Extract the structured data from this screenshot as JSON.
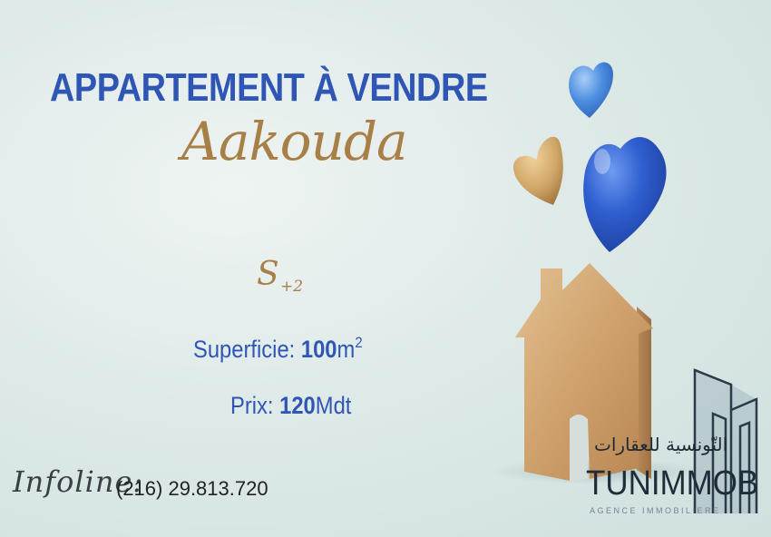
{
  "listing": {
    "title": "APPARTEMENT À VENDRE",
    "location": "Aakouda",
    "type_main": "S",
    "type_sup": "+2",
    "surface_label": "Superficie:",
    "surface_value": "100",
    "surface_unit": "m",
    "surface_sup": "2",
    "price_label": "Prix:",
    "price_value": "120",
    "price_unit": "Mdt"
  },
  "contact": {
    "label": "Infoline:",
    "phone": "(216) 29.813.720"
  },
  "logo": {
    "arabic": "التّونسية للعقارات",
    "name": "TUNIMMOB",
    "tagline": "AGENCE IMMOBILIERE"
  },
  "colors": {
    "primary_blue": "#2f56b4",
    "gold": "#a97f48",
    "background": "#dbe8e6"
  }
}
